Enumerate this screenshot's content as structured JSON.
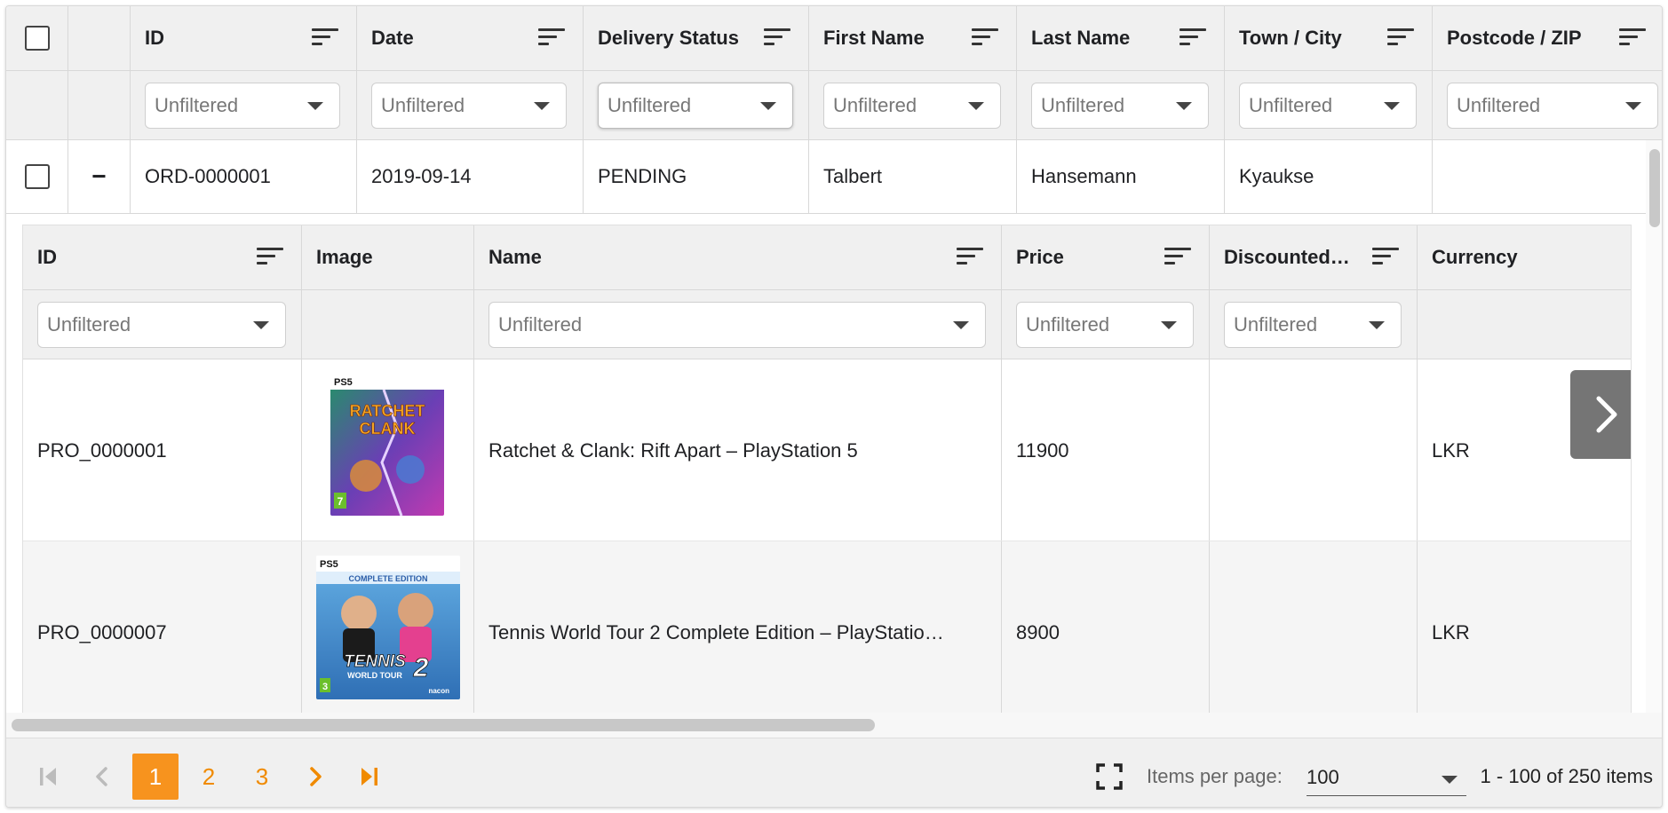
{
  "main_grid": {
    "columns": [
      "ID",
      "Date",
      "Delivery Status",
      "First Name",
      "Last Name",
      "Town / City",
      "Postcode / ZIP"
    ],
    "filter_placeholder": "Unfiltered",
    "row": {
      "id": "ORD-0000001",
      "date": "2019-09-14",
      "status": "PENDING",
      "first_name": "Talbert",
      "last_name": "Hansemann",
      "town": "Kyaukse",
      "postcode": ""
    },
    "collapse_symbol": "−"
  },
  "detail_grid": {
    "columns": [
      "ID",
      "Image",
      "Name",
      "Price",
      "Discounted…",
      "Currency"
    ],
    "filter_placeholder": "Unfiltered",
    "rows": [
      {
        "id": "PRO_0000001",
        "image": "Ratchet & Clank: Rift Apart cover",
        "name": "Ratchet & Clank: Rift Apart – PlayStation 5",
        "price": "11900",
        "discounted": "",
        "currency": "LKR"
      },
      {
        "id": "PRO_0000007",
        "image": "Tennis World Tour 2 cover",
        "name": "Tennis World Tour 2 Complete Edition – PlayStatio…",
        "price": "8900",
        "discounted": "",
        "currency": "LKR"
      }
    ],
    "cover1": {
      "platform": "PS5",
      "title_line1": "RATCHET",
      "title_line2": "CLANK",
      "rating": "7"
    },
    "cover2": {
      "platform": "PS5",
      "banner": "COMPLETE EDITION",
      "title_line1": "TENNIS",
      "title_line2": "WORLD TOUR",
      "title_num": "2",
      "rating": "3",
      "publisher": "nacon"
    }
  },
  "pager": {
    "pages": [
      "1",
      "2",
      "3"
    ],
    "current_page": "1",
    "items_per_page_label": "Items per page:",
    "items_per_page_value": "100",
    "summary": "1 - 100 of 250 items"
  },
  "colors": {
    "accent": "#f7931e",
    "header_bg": "#f0f0f0",
    "stripe_bg": "#f5f5f5"
  }
}
